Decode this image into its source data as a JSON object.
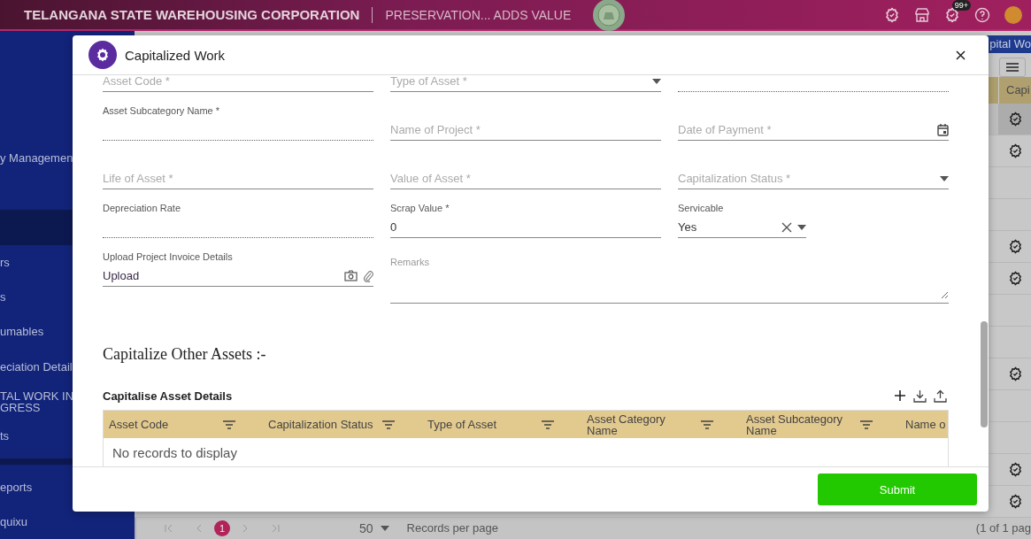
{
  "header": {
    "title": "TELANGANA STATE WAREHOUSING CORPORATION",
    "tagline": "PRESERVATION... ADDS VALUE",
    "notification_badge": "99+"
  },
  "sidebar": {
    "items": [
      {
        "label": "y Managemen",
        "selected": false
      },
      {
        "selected": true
      },
      {
        "label": "rs",
        "selected": false
      },
      {
        "label": "s",
        "selected": false
      },
      {
        "label": "umables",
        "selected": false
      },
      {
        "label": "eciation Detail",
        "selected": false
      },
      {
        "label": "TAL WORK IN\nGRESS",
        "selected": false
      },
      {
        "label": "ts",
        "selected": false
      },
      {
        "label": "eports",
        "selected": false
      },
      {
        "label": "quixu",
        "selected": false
      }
    ]
  },
  "background_page": {
    "tab": "pital Wo",
    "column_header": "Capi",
    "rows": [
      {
        "action": true,
        "selected": true
      },
      {
        "action": true,
        "selected": false
      },
      {
        "action": false,
        "selected": false
      },
      {
        "action": false,
        "selected": false
      },
      {
        "action": true,
        "selected": false
      },
      {
        "action": true,
        "selected": false
      },
      {
        "action": false,
        "selected": false
      },
      {
        "action": false,
        "selected": false
      },
      {
        "action": true,
        "selected": false
      },
      {
        "action": false,
        "selected": false
      },
      {
        "action": false,
        "selected": false
      },
      {
        "action": true,
        "selected": false
      },
      {
        "action": true,
        "selected": false
      }
    ],
    "pager": {
      "current_page": "1",
      "page_size": "50",
      "page_size_label": "Records per page",
      "summary": "(1 of 1 pag"
    }
  },
  "dialog": {
    "title": "Capitalized Work",
    "fields": [
      {
        "kind": "text",
        "placeholder": "Asset Code *",
        "disabled": false
      },
      {
        "kind": "select",
        "placeholder": "Type of Asset *",
        "disabled": false
      },
      {
        "kind": "text",
        "disabled": true
      },
      {
        "kind": "text",
        "label": "Asset Subcategory Name *",
        "disabled": true
      },
      {
        "kind": "text",
        "placeholder": "Name of Project *",
        "disabled": false
      },
      {
        "kind": "date",
        "placeholder": "Date of Payment *",
        "disabled": false
      },
      {
        "kind": "text",
        "placeholder": "Life of Asset *",
        "disabled": false
      },
      {
        "kind": "text",
        "placeholder": "Value of Asset *",
        "disabled": false
      },
      {
        "kind": "select",
        "placeholder": "Capitalization Status *",
        "disabled": false
      },
      {
        "kind": "text",
        "label": "Depreciation Rate",
        "disabled": true
      },
      {
        "kind": "text",
        "label": "Scrap Value *",
        "value": "0",
        "disabled": false
      },
      {
        "kind": "clearable-select",
        "label": "Servicable",
        "value": "Yes",
        "disabled": false
      },
      {
        "kind": "upload",
        "label": "Upload Project Invoice Details",
        "value": "Upload",
        "disabled": false
      },
      {
        "kind": "textarea",
        "placeholder": "Remarks",
        "disabled": false
      }
    ],
    "section_title": "Capitalize Other Assets :-",
    "table": {
      "title": "Capitalise Asset Details",
      "columns": [
        {
          "label": "Asset Code",
          "filter": true
        },
        {
          "label": "Capitalization Status",
          "filter": true
        },
        {
          "label": "Type of Asset",
          "filter": true
        },
        {
          "label": "Asset Category Name",
          "filter": true
        },
        {
          "label": "Asset Subcategory Name",
          "filter": true
        },
        {
          "label": "Name o",
          "filter": false
        }
      ],
      "empty_message": "No records to display"
    },
    "submit": "Submit"
  }
}
